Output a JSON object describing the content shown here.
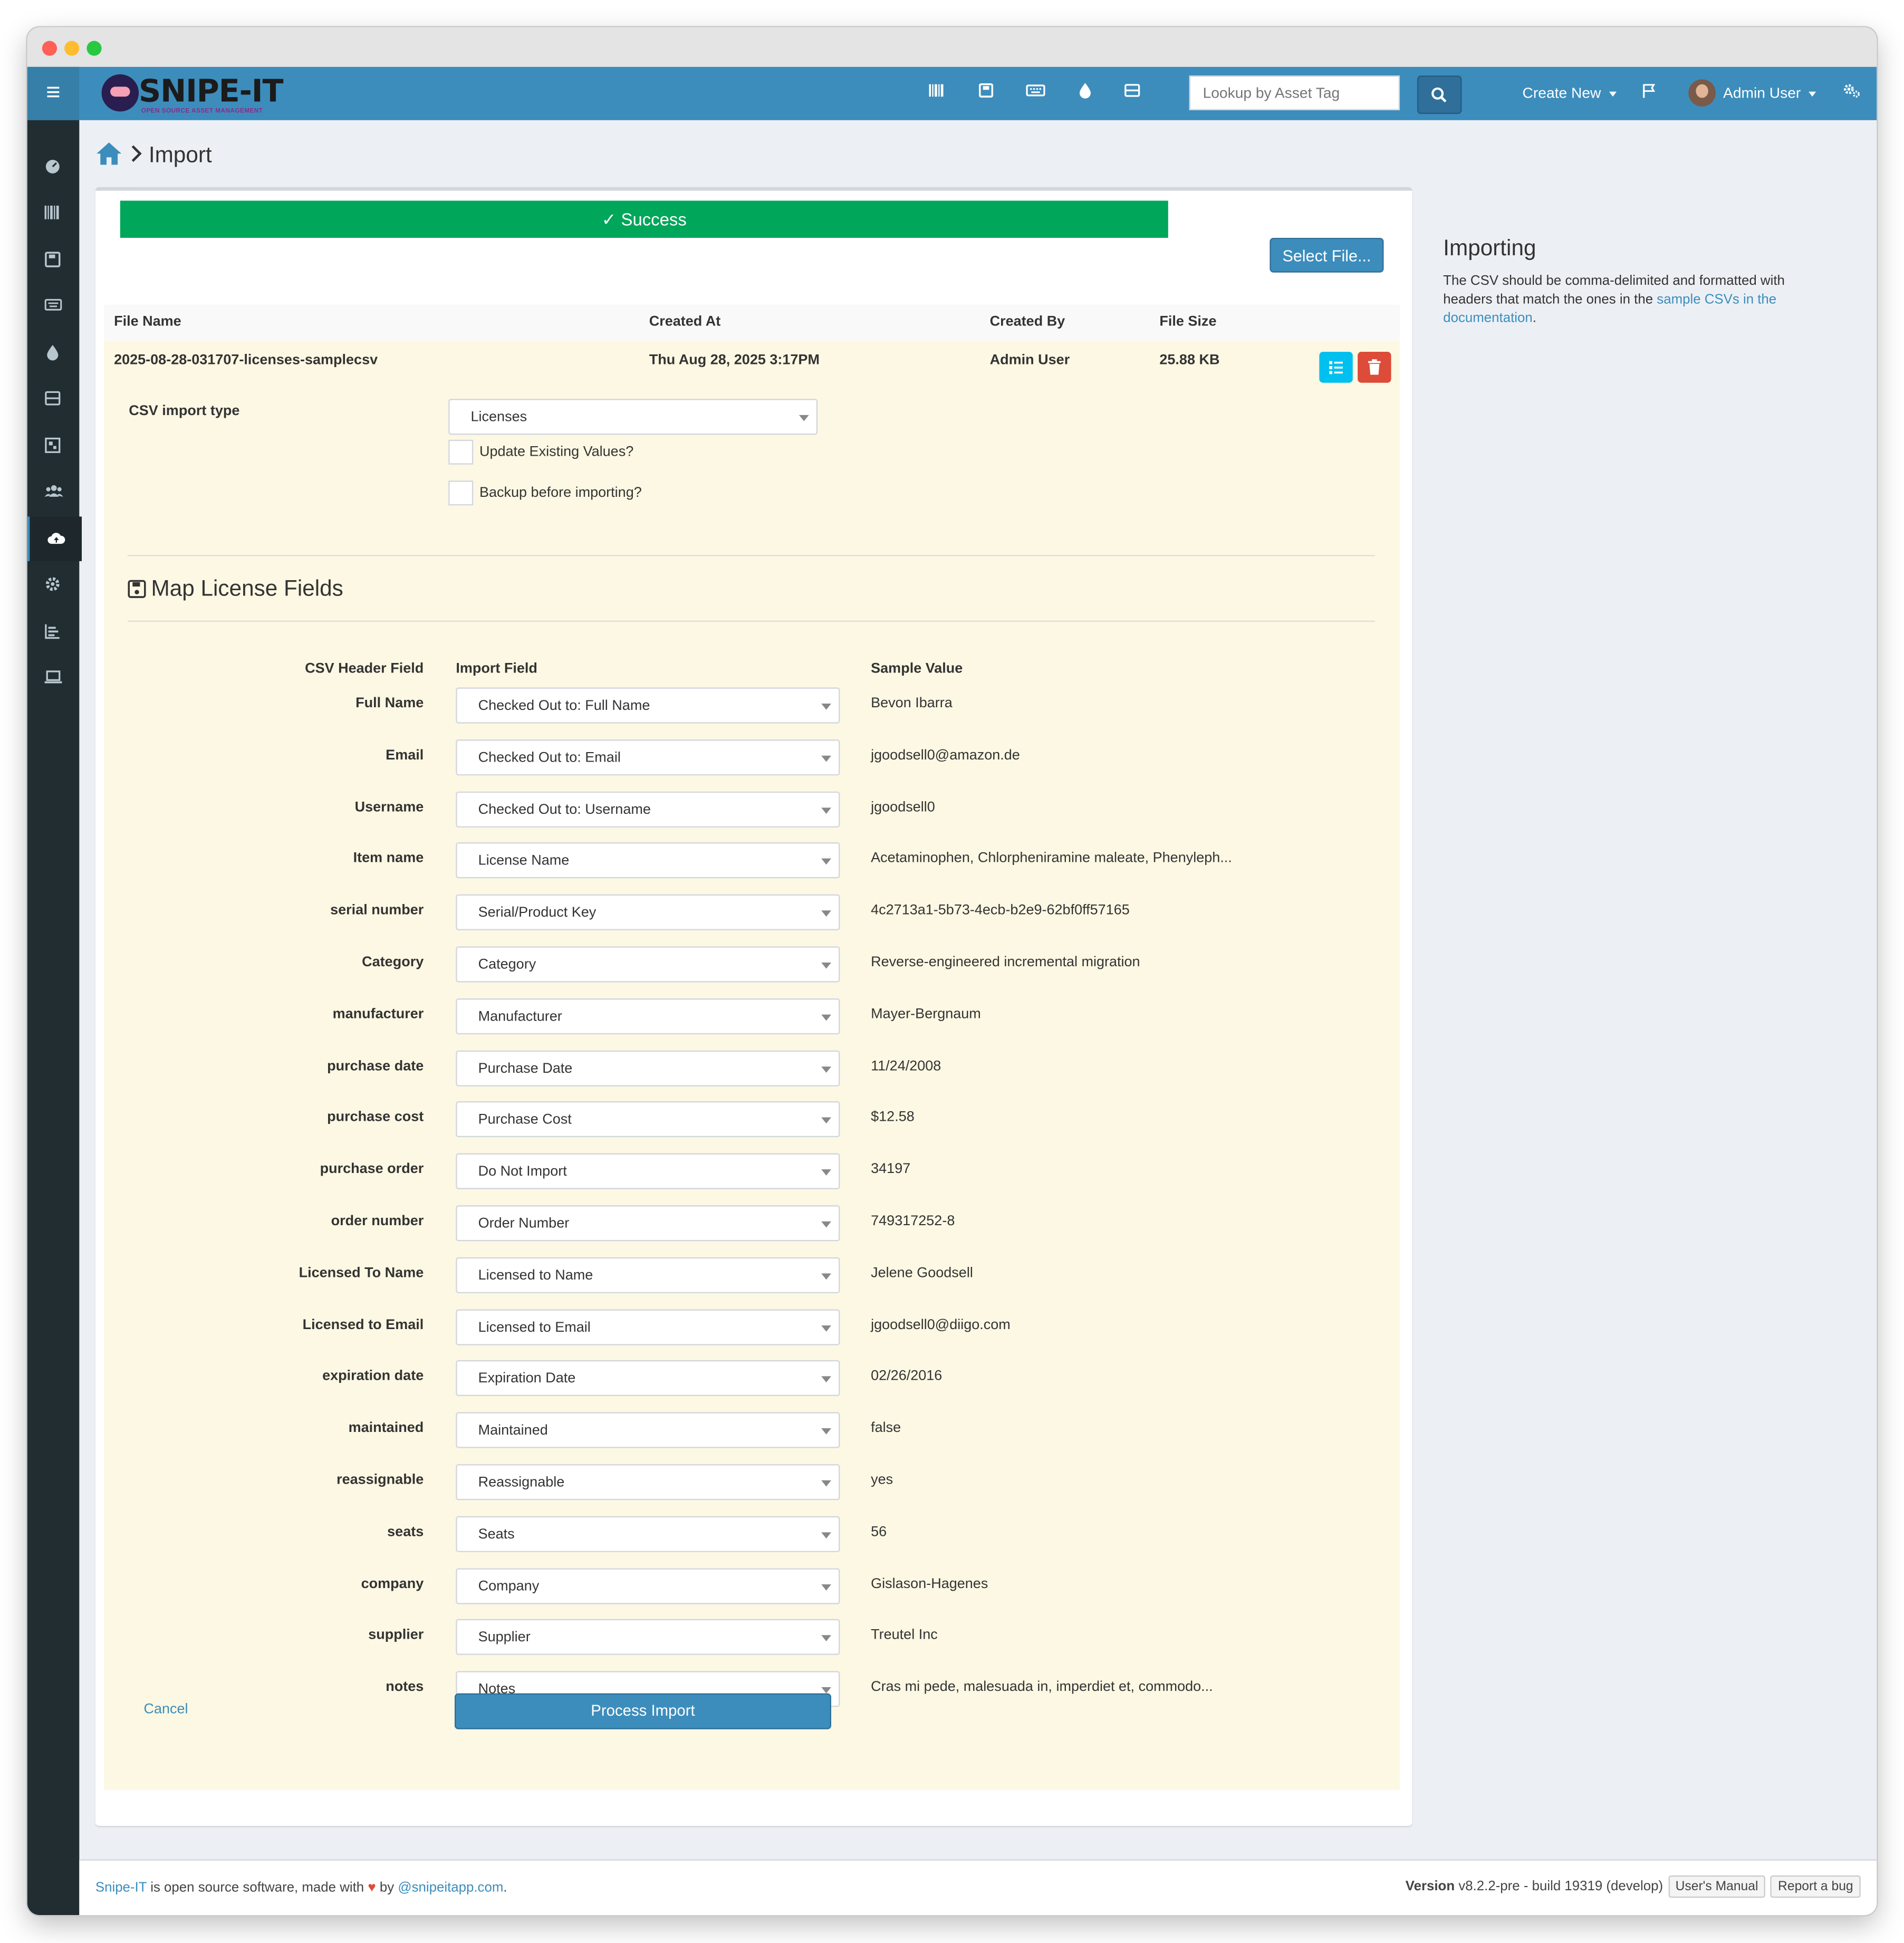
{
  "app": {
    "logo_text": "SNIPE-IT",
    "logo_subtitle": "OPEN SOURCE ASSET MANAGEMENT"
  },
  "header": {
    "search_placeholder": "Lookup by Asset Tag",
    "create_new_label": "Create New",
    "user_name": "Admin User",
    "icons": [
      "barcode-icon",
      "hdd-icon",
      "keyboard-icon",
      "tint-icon",
      "server-icon"
    ]
  },
  "sidebar": {
    "items": [
      {
        "icon": "dashboard-icon"
      },
      {
        "icon": "barcode-icon"
      },
      {
        "icon": "floppy-icon"
      },
      {
        "icon": "keyboard-icon"
      },
      {
        "icon": "tint-icon"
      },
      {
        "icon": "server-icon"
      },
      {
        "icon": "kit-icon"
      },
      {
        "icon": "users-icon"
      },
      {
        "icon": "cloud-upload-icon",
        "active": true
      },
      {
        "icon": "cog-icon"
      },
      {
        "icon": "reports-icon"
      },
      {
        "icon": "laptop-icon"
      }
    ]
  },
  "breadcrumb": {
    "current": "Import"
  },
  "import_box": {
    "status": "Success",
    "select_file_label": "Select File...",
    "columns": [
      "File Name",
      "Created At",
      "Created By",
      "File Size"
    ],
    "file": {
      "name": "2025-08-28-031707-licenses-samplecsv",
      "created_at": "Thu Aug 28, 2025 3:17PM",
      "created_by": "Admin User",
      "size": "25.88 KB"
    },
    "csv_import_type_label": "CSV import type",
    "csv_import_type_value": "Licenses",
    "update_existing_label": "Update Existing Values?",
    "backup_label": "Backup before importing?",
    "map_title": "Map License Fields",
    "mapping_headers": {
      "csv_header": "CSV Header Field",
      "import_field": "Import Field",
      "sample_value": "Sample Value"
    },
    "mappings": [
      {
        "csv": "Full Name",
        "field": "Checked Out to: Full Name",
        "sample": "Bevon Ibarra"
      },
      {
        "csv": "Email",
        "field": "Checked Out to: Email",
        "sample": "jgoodsell0@amazon.de"
      },
      {
        "csv": "Username",
        "field": "Checked Out to: Username",
        "sample": "jgoodsell0"
      },
      {
        "csv": "Item name",
        "field": "License Name",
        "sample": "Acetaminophen, Chlorpheniramine maleate, Phenyleph..."
      },
      {
        "csv": "serial number",
        "field": "Serial/Product Key",
        "sample": "4c2713a1-5b73-4ecb-b2e9-62bf0ff57165"
      },
      {
        "csv": "Category",
        "field": "Category",
        "sample": "Reverse-engineered incremental migration"
      },
      {
        "csv": "manufacturer",
        "field": "Manufacturer",
        "sample": "Mayer-Bergnaum"
      },
      {
        "csv": "purchase date",
        "field": "Purchase Date",
        "sample": "11/24/2008"
      },
      {
        "csv": "purchase cost",
        "field": "Purchase Cost",
        "sample": "$12.58"
      },
      {
        "csv": "purchase order",
        "field": "Do Not Import",
        "sample": "34197"
      },
      {
        "csv": "order number",
        "field": "Order Number",
        "sample": "749317252-8"
      },
      {
        "csv": "Licensed To Name",
        "field": "Licensed to Name",
        "sample": "Jelene Goodsell"
      },
      {
        "csv": "Licensed to Email",
        "field": "Licensed to Email",
        "sample": "jgoodsell0@diigo.com"
      },
      {
        "csv": "expiration date",
        "field": "Expiration Date",
        "sample": "02/26/2016"
      },
      {
        "csv": "maintained",
        "field": "Maintained",
        "sample": "false"
      },
      {
        "csv": "reassignable",
        "field": "Reassignable",
        "sample": "yes"
      },
      {
        "csv": "seats",
        "field": "Seats",
        "sample": "56"
      },
      {
        "csv": "company",
        "field": "Company",
        "sample": "Gislason-Hagenes"
      },
      {
        "csv": "supplier",
        "field": "Supplier",
        "sample": "Treutel Inc"
      },
      {
        "csv": "notes",
        "field": "Notes",
        "sample": "Cras mi pede, malesuada in, imperdiet et, commodo..."
      }
    ],
    "cancel_label": "Cancel",
    "process_label": "Process Import"
  },
  "side_panel": {
    "title": "Importing",
    "text_before": "The CSV should be comma-delimited and formatted with headers that match the ones in the ",
    "link_text": "sample CSVs in the documentation",
    "text_after": "."
  },
  "footer": {
    "brand_link": "Snipe-IT",
    "text_mid": " is open source software, made with ",
    "text_by": " by ",
    "handle_link": "@snipeitapp.com",
    "text_end": ".",
    "version_label": "Version",
    "version_value": " v8.2.2-pre - build 19319 (develop)",
    "manual_label": "User's Manual",
    "bug_label": "Report a bug"
  },
  "colors": {
    "header": "#3c8dbc",
    "sidebar": "#222d32",
    "success": "#00a65a",
    "danger": "#dd4b39",
    "info": "#00c0ef",
    "detail_bg": "#fcf8e3"
  }
}
